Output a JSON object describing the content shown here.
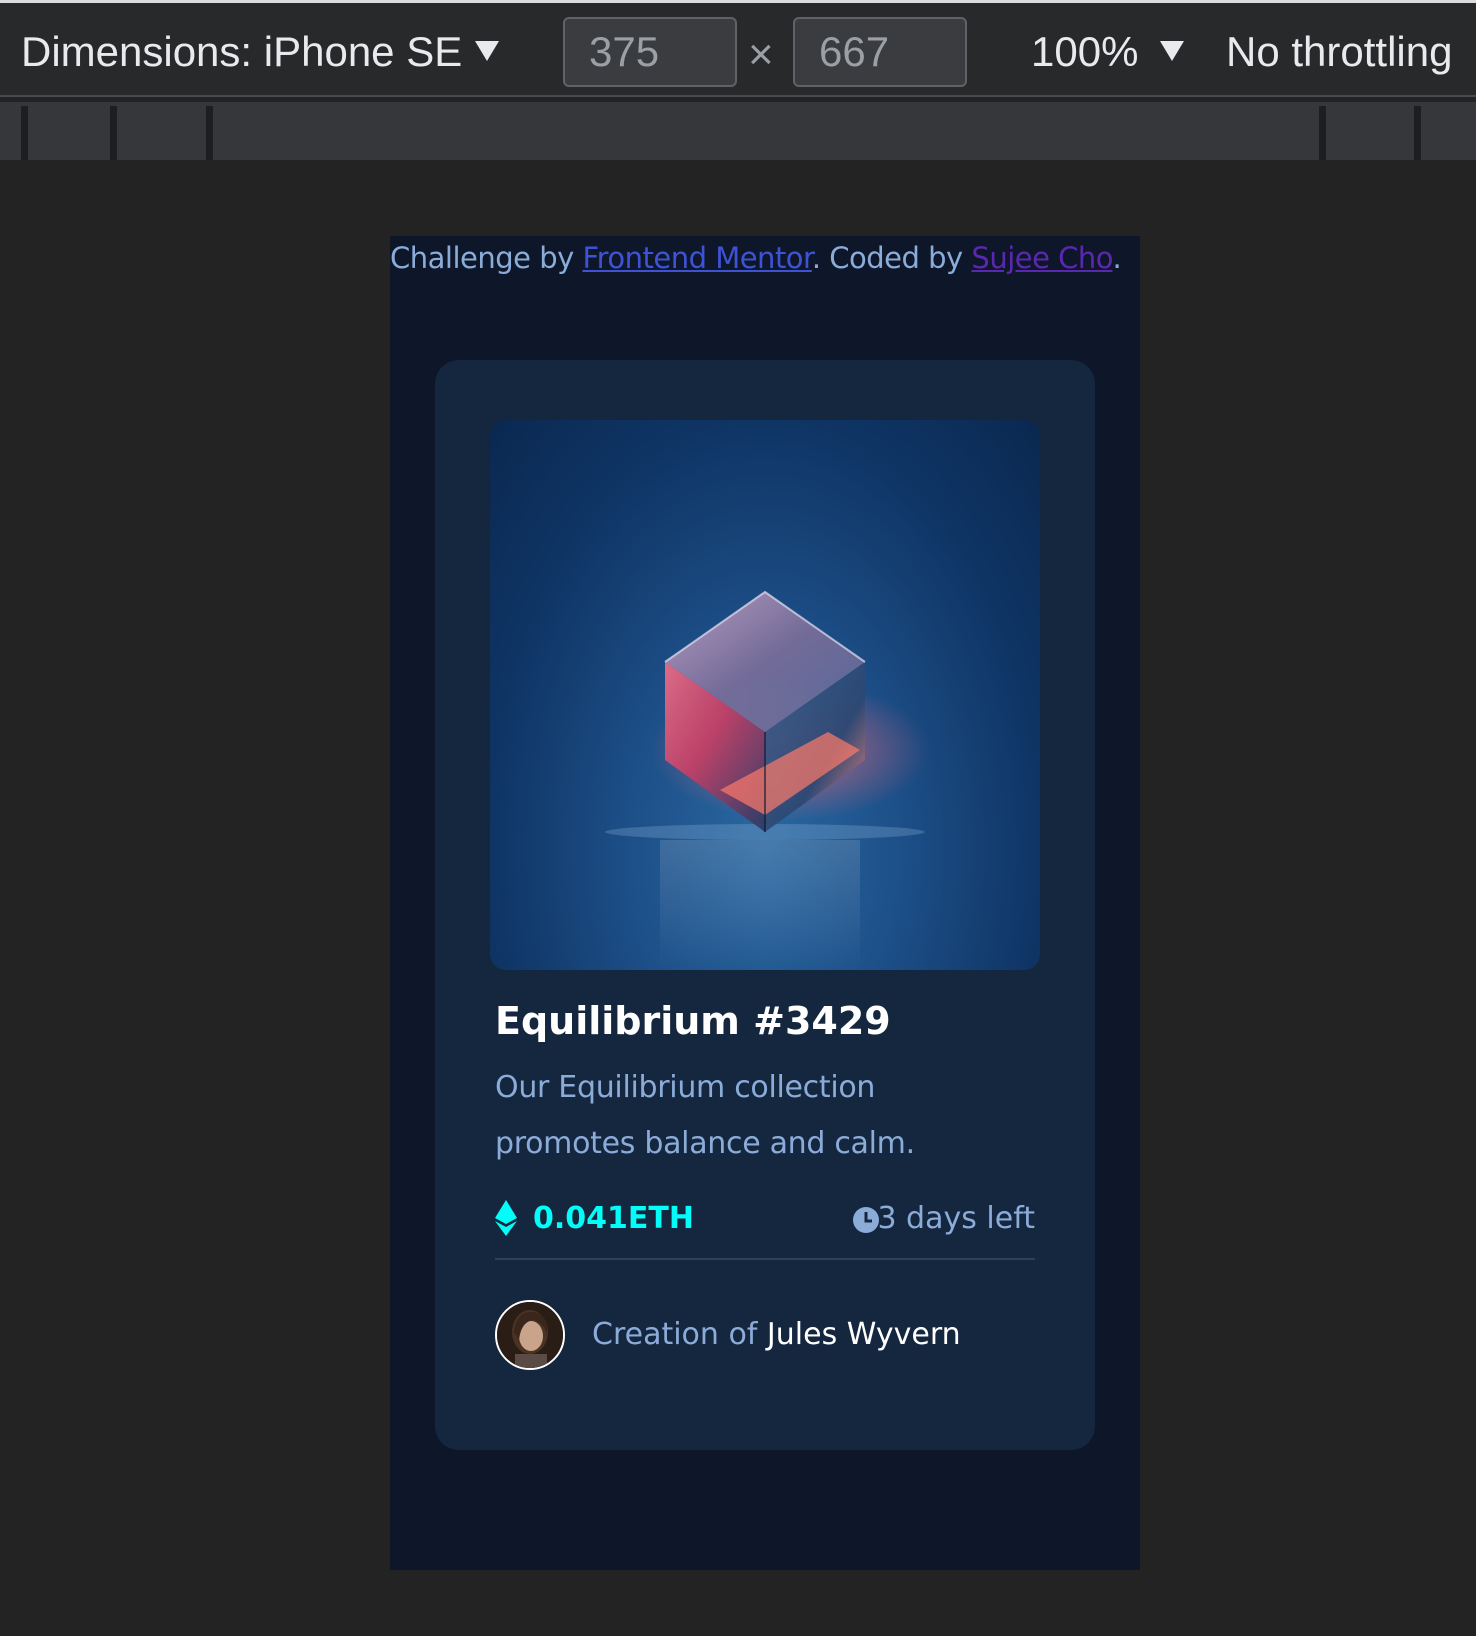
{
  "devtools": {
    "device_label": "Dimensions: iPhone SE",
    "width_value": "375",
    "height_value": "667",
    "times_symbol": "×",
    "zoom_label": "100%",
    "throttling_label": "No throttling"
  },
  "page": {
    "attribution": {
      "prefix": "Challenge by ",
      "frontend_link": "Frontend Mentor",
      "middle": ". Coded by ",
      "author_link": "Sujee Cho",
      "suffix": "."
    },
    "card": {
      "image_alt": "Equilibrium cube",
      "title": "Equilibrium #3429",
      "description": "Our Equilibrium collection promotes balance and calm.",
      "price": "0.041ETH",
      "time_left": "3 days left",
      "creator_prefix": "Creation of ",
      "creator_name": "Jules Wyvern"
    }
  },
  "colors": {
    "page_bg": "#0e1729",
    "card_bg": "#15263f",
    "soft_blue": "#8bacd9",
    "cyan": "#00fff8",
    "white": "#ffffff",
    "link_blue": "#3e52d6",
    "link_purple": "#5a27b0"
  },
  "icons": [
    "dropdown-arrow-icon",
    "ethereum-icon",
    "clock-icon"
  ]
}
